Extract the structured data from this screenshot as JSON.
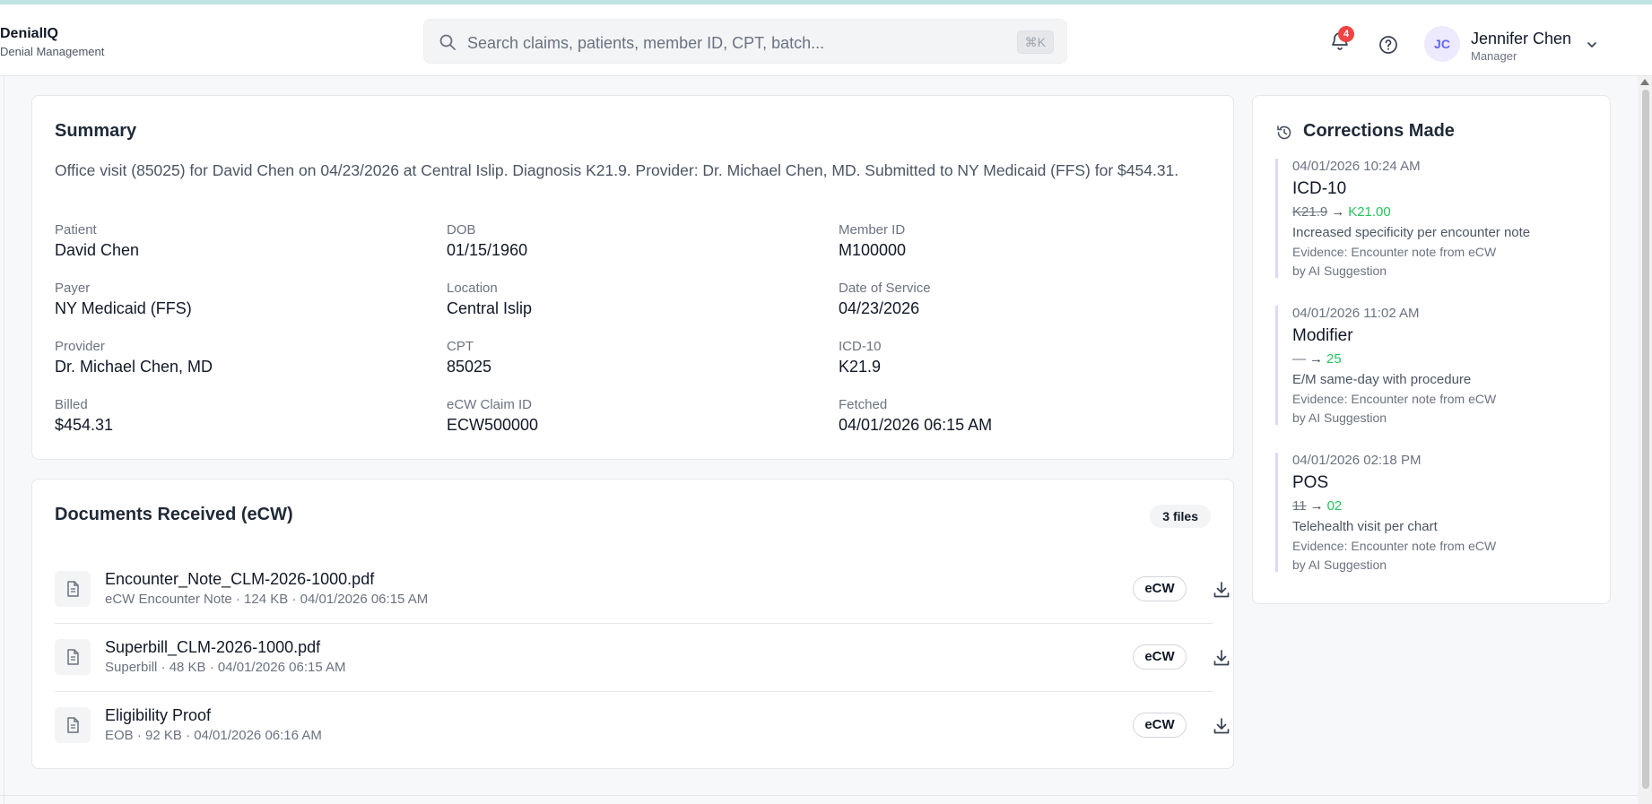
{
  "header": {
    "brand_name": "DenialIQ",
    "brand_sub": "Denial Management",
    "search_placeholder": "Search claims, patients, member ID, CPT, batch...",
    "search_shortcut": "⌘K",
    "notification_count": "4",
    "user_initials": "JC",
    "user_name": "Jennifer Chen",
    "user_role": "Manager"
  },
  "summary": {
    "title": "Summary",
    "text": "Office visit (85025) for David Chen on 04/23/2026 at Central Islip. Diagnosis K21.9. Provider: Dr. Michael Chen, MD. Submitted to NY Medicaid (FFS) for $454.31.",
    "fields": [
      {
        "label": "Patient",
        "value": "David Chen"
      },
      {
        "label": "DOB",
        "value": "01/15/1960"
      },
      {
        "label": "Member ID",
        "value": "M100000"
      },
      {
        "label": "Payer",
        "value": "NY Medicaid (FFS)"
      },
      {
        "label": "Location",
        "value": "Central Islip"
      },
      {
        "label": "Date of Service",
        "value": "04/23/2026"
      },
      {
        "label": "Provider",
        "value": "Dr. Michael Chen, MD"
      },
      {
        "label": "CPT",
        "value": "85025"
      },
      {
        "label": "ICD-10",
        "value": "K21.9"
      },
      {
        "label": "Billed",
        "value": "$454.31"
      },
      {
        "label": "eCW Claim ID",
        "value": "ECW500000"
      },
      {
        "label": "Fetched",
        "value": "04/01/2026 06:15 AM"
      }
    ]
  },
  "documents": {
    "title": "Documents Received (eCW)",
    "count": "3 files",
    "files": [
      {
        "name": "Encounter_Note_CLM-2026-1000.pdf",
        "meta": "eCW Encounter Note · 124 KB · 04/01/2026 06:15 AM",
        "source": "eCW"
      },
      {
        "name": "Superbill_CLM-2026-1000.pdf",
        "meta": "Superbill · 48 KB · 04/01/2026 06:15 AM",
        "source": "eCW"
      },
      {
        "name": "Eligibility Proof",
        "meta": "EOB · 92 KB · 04/01/2026 06:16 AM",
        "source": "eCW"
      }
    ]
  },
  "corrections": {
    "title": "Corrections Made",
    "items": [
      {
        "timestamp": "04/01/2026 10:24 AM",
        "field": "ICD-10",
        "old": "K21.9",
        "new": "K21.00",
        "reason": "Increased specificity per encounter note",
        "evidence": "Evidence: Encounter note from eCW",
        "by": "by AI Suggestion"
      },
      {
        "timestamp": "04/01/2026 11:02 AM",
        "field": "Modifier",
        "old": "—",
        "new": "25",
        "reason": "E/M same-day with procedure",
        "evidence": "Evidence: Encounter note from eCW",
        "by": "by AI Suggestion"
      },
      {
        "timestamp": "04/01/2026 02:18 PM",
        "field": "POS",
        "old": "11",
        "new": "02",
        "reason": "Telehealth visit per chart",
        "evidence": "Evidence: Encounter note from eCW",
        "by": "by AI Suggestion"
      }
    ]
  }
}
